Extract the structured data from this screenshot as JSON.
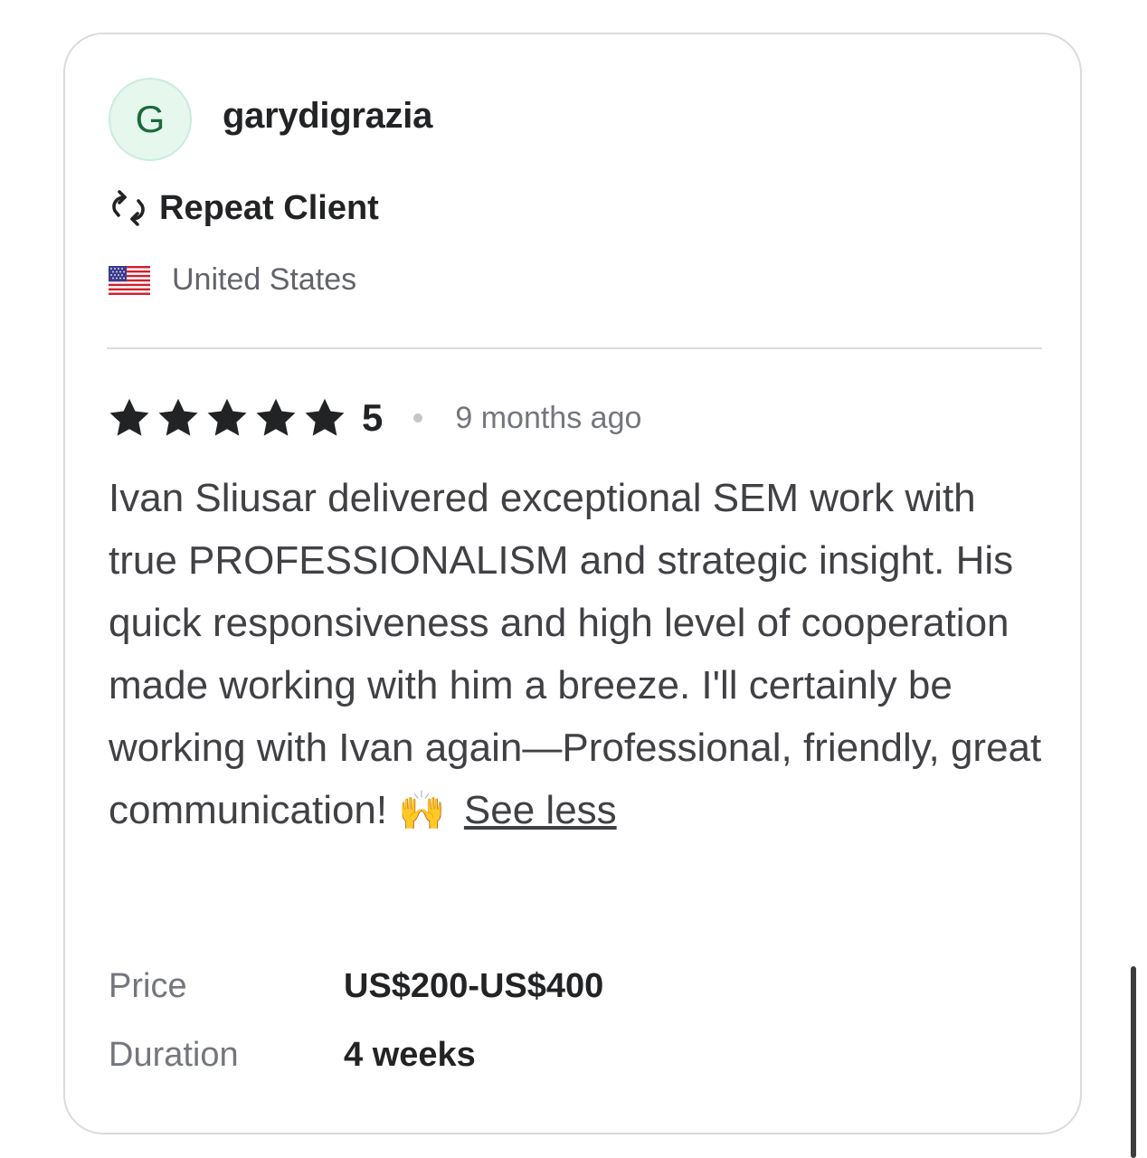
{
  "reviewer": {
    "avatar_initial": "G",
    "username": "garydigrazia",
    "badge_label": "Repeat Client",
    "badge_icon": "repeat-icon",
    "country": "United States",
    "country_flag_icon": "us-flag-icon"
  },
  "review": {
    "rating_value": "5",
    "stars_filled": 5,
    "time_ago": "9 months ago",
    "text": "Ivan Sliusar delivered exceptional SEM work with true PROFESSIONALISM and strategic insight. His quick responsiveness and high level of cooperation made working with him a breeze. I'll certainly be working with Ivan again—Professional, friendly, great communication!",
    "emoji": "🙌",
    "toggle_label": "See less"
  },
  "details": {
    "price_label": "Price",
    "price_value": "US$200-US$400",
    "duration_label": "Duration",
    "duration_value": "4 weeks"
  },
  "colors": {
    "avatar_bg": "#e6f7ee",
    "avatar_text": "#1a6b3c",
    "text_primary": "#222325",
    "text_secondary": "#74767e",
    "border": "#dadbdd"
  }
}
